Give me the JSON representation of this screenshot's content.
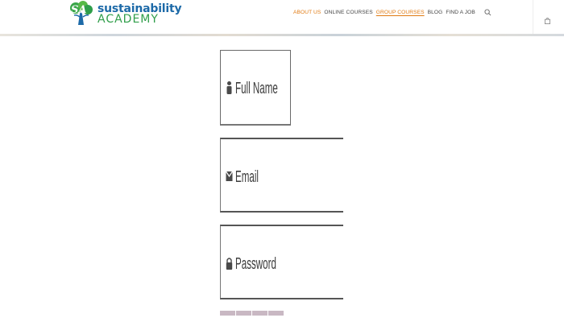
{
  "header": {
    "logo": {
      "monogram": "SA",
      "line1": "sustainability",
      "line2": "ACADEMY"
    },
    "nav": [
      {
        "label": "ABOUT US",
        "style": "orange"
      },
      {
        "label": "ONLINE COURSES",
        "style": "normal"
      },
      {
        "label": "GROUP COURSES",
        "style": "orange-underlined"
      },
      {
        "label": "BLOG",
        "style": "normal"
      },
      {
        "label": "FIND A JOB",
        "style": "normal"
      }
    ],
    "icons": {
      "search": "search-icon",
      "cart": "shopping-bag-icon"
    }
  },
  "form": {
    "full_name": {
      "label": "Full Name",
      "icon": "person-icon"
    },
    "email": {
      "label": "Email",
      "icon": "envelope-icon"
    },
    "password": {
      "label": "Password",
      "icon": "lock-icon"
    }
  },
  "colors": {
    "accent_orange": "#e07a12",
    "logo_blue": "#1d6aa8",
    "logo_green": "#2f9e4a",
    "captcha_bar": "#c9b8c3"
  }
}
